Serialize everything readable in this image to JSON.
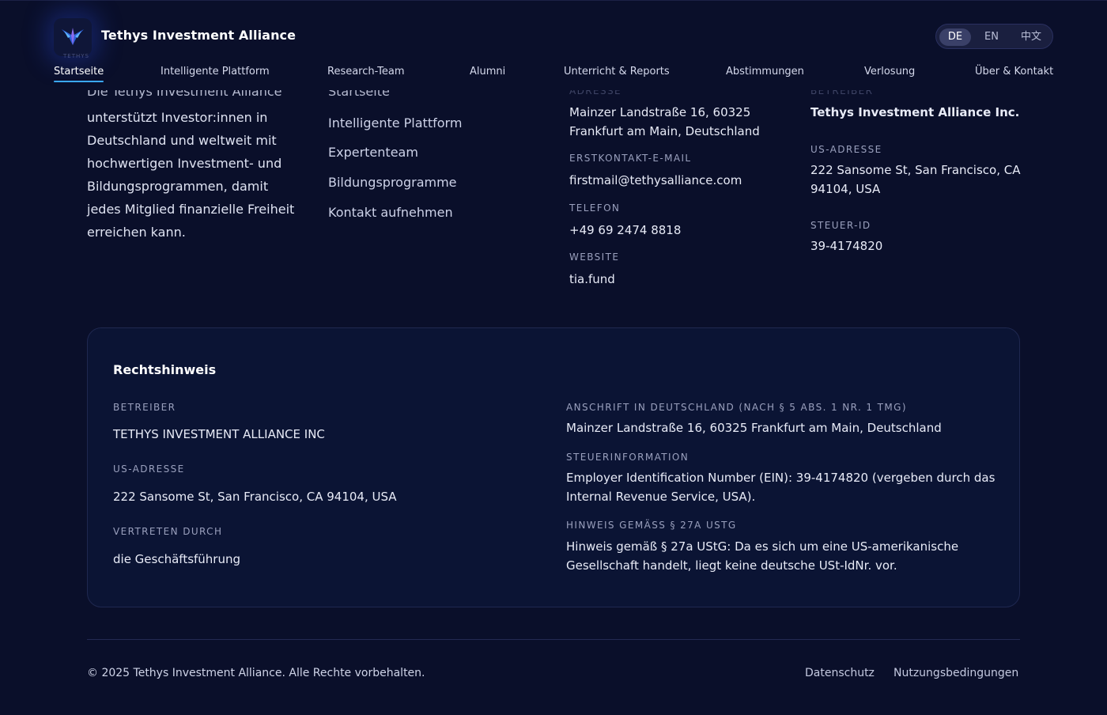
{
  "header": {
    "brand": "Tethys Investment Alliance",
    "logo_text": "TETHYS",
    "languages": [
      "DE",
      "EN",
      "中文"
    ],
    "active_language": "DE",
    "nav": [
      "Startseite",
      "Intelligente Plattform",
      "Research-Team",
      "Alumni",
      "Unterricht & Reports",
      "Abstimmungen",
      "Verlosung",
      "Über & Kontakt"
    ],
    "active_nav": "Startseite"
  },
  "about": {
    "ghost_first_line": "Die Tethys Investment Alliance",
    "lines": [
      "unterstützt Investor:innen in",
      "Deutschland und weltweit mit",
      "hochwertigen Investment- und",
      "Bildungsprogrammen, damit",
      "jedes Mitglied finanzielle Freiheit",
      "erreichen kann."
    ]
  },
  "quicklinks": {
    "ghost_first": "Startseite",
    "items": [
      "Intelligente Plattform",
      "Expertenteam",
      "Bildungsprogramme",
      "Kontakt aufnehmen"
    ]
  },
  "contact": {
    "ghost_label": "ADRESSE",
    "address": [
      "Mainzer Landstraße 16, 60325",
      "Frankfurt am Main, Deutschland"
    ],
    "email_label": "ERSTKONTAKT-E-MAIL",
    "email": "firstmail@tethysalliance.com",
    "phone_label": "TELEFON",
    "phone": "+49 69 2474 8818",
    "website_label": "WEBSITE",
    "website": "tia.fund"
  },
  "operator": {
    "ghost_label": "BETREIBER",
    "name": "Tethys Investment Alliance Inc.",
    "us_address_label": "US-ADRESSE",
    "us_address": [
      "222 Sansome St, San Francisco, CA",
      "94104, USA"
    ],
    "tax_id_label": "STEUER-ID",
    "tax_id": "39-4174820"
  },
  "legal": {
    "title": "Rechtshinweis",
    "operator_label": "BETREIBER",
    "operator": "TETHYS INVESTMENT ALLIANCE INC",
    "us_address_label": "US-ADRESSE",
    "us_address": "222 Sansome St, San Francisco, CA 94104, USA",
    "represented_label": "VERTRETEN DURCH",
    "represented": "die Geschäftsführung",
    "de_address_label": "ANSCHRIFT IN DEUTSCHLAND (NACH § 5 ABS. 1 NR. 1 TMG)",
    "de_address": "Mainzer Landstraße 16, 60325 Frankfurt am Main, Deutschland",
    "tax_info_label": "STEUERINFORMATION",
    "tax_info": [
      "Employer Identification Number (EIN): 39-4174820 (vergeben durch das",
      "Internal Revenue Service, USA)."
    ],
    "ustg_label": "HINWEIS GEMÄSS § 27A USTG",
    "ustg": [
      "Hinweis gemäß § 27a UStG: Da es sich um eine US-amerikanische",
      "Gesellschaft handelt, liegt keine deutsche USt-IdNr. vor."
    ]
  },
  "footer": {
    "copyright": "© 2025 Tethys Investment Alliance. Alle Rechte vorbehalten.",
    "links": [
      "Datenschutz",
      "Nutzungsbedingungen"
    ]
  },
  "colors": {
    "background": "#0a0f2a",
    "accent": "#3aa8ff",
    "card": "#0b1434"
  }
}
